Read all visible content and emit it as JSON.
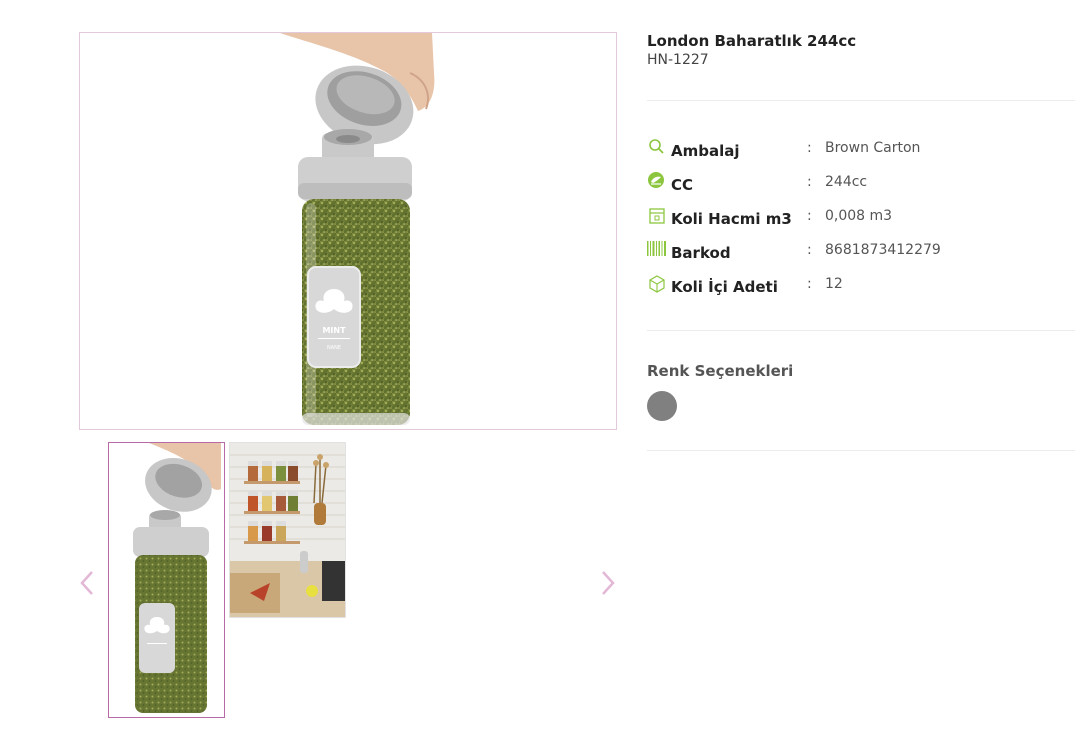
{
  "product": {
    "title": "London Baharatlık 244cc",
    "code": "HN-1227"
  },
  "jar_label": {
    "name": "MINT",
    "subtitle": "NANE"
  },
  "specs": [
    {
      "icon": "magnifier-icon",
      "label": "Ambalaj",
      "value": "Brown Carton"
    },
    {
      "icon": "cc-leaf-icon",
      "label": "CC",
      "value": "244cc"
    },
    {
      "icon": "box-icon",
      "label": "Koli Hacmi m3",
      "value": "0,008 m3"
    },
    {
      "icon": "barcode-icon",
      "label": "Barkod",
      "value": "8681873412279"
    },
    {
      "icon": "package-icon",
      "label": "Koli İçi Adeti",
      "value": "12"
    }
  ],
  "spec_separator": ":",
  "colors": {
    "title": "Renk Seçenekleri",
    "options": [
      {
        "color": "#808080"
      }
    ]
  },
  "gallery": {
    "thumbnails": [
      "jar-with-hand",
      "kitchen-shelf-scene"
    ],
    "selected_index": 0
  },
  "theme": {
    "accent": "#b86aa6",
    "icon_green": "#8cc63f"
  }
}
